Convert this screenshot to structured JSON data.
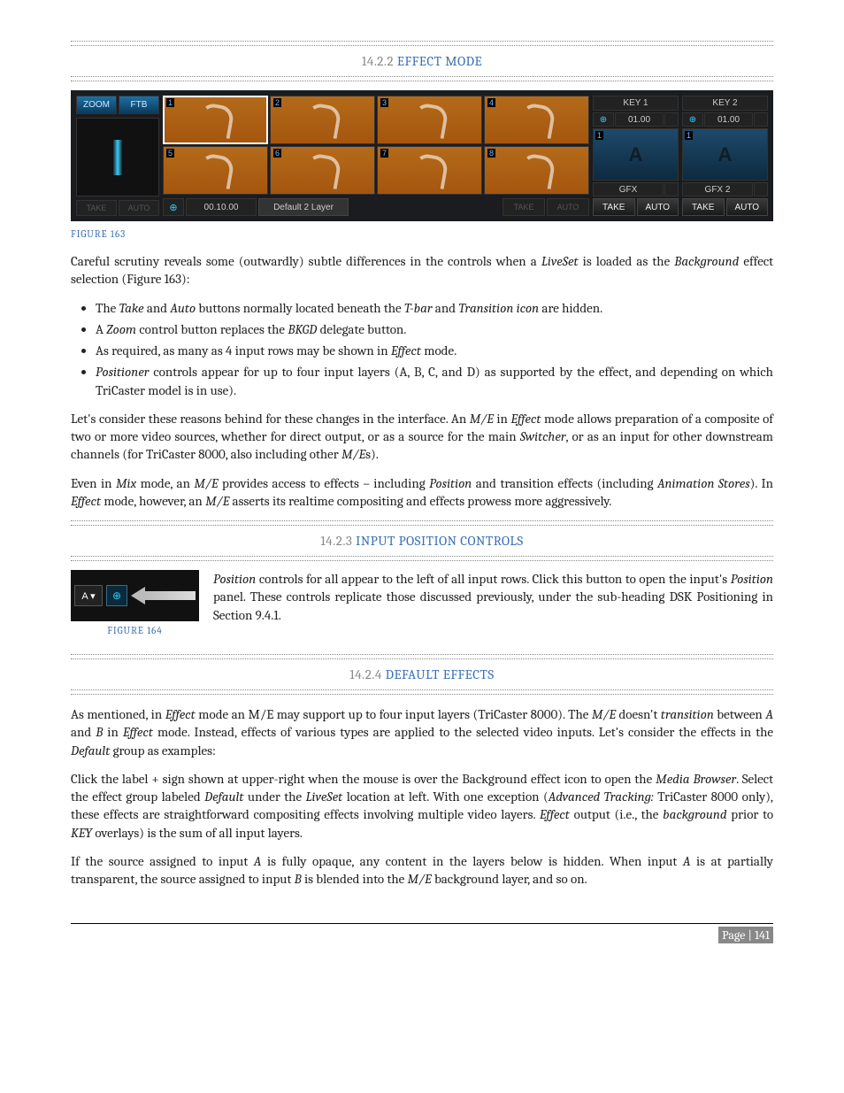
{
  "section1": {
    "num": "14.2.2",
    "title": "EFFECT MODE"
  },
  "fig163": {
    "caption": "FIGURE 163",
    "zoom": "ZOOM",
    "ftb": "FTB",
    "take": "TAKE",
    "auto": "AUTO",
    "tiles": [
      "1",
      "2",
      "3",
      "4",
      "5",
      "6",
      "7",
      "8"
    ],
    "time": "00.10.00",
    "default": "Default  2 Layer",
    "pos": "⊕",
    "keys": [
      {
        "hdr": "KEY 1",
        "time": "01.00",
        "thumb": "A",
        "tl": "1",
        "gfx": "GFX",
        "take": "TAKE",
        "auto": "AUTO"
      },
      {
        "hdr": "KEY 2",
        "time": "01.00",
        "thumb": "A",
        "tl": "1",
        "gfx": "GFX 2",
        "take": "TAKE",
        "auto": "AUTO"
      }
    ]
  },
  "body1": {
    "p1a": "Careful scrutiny reveals some (outwardly) subtle differences in the controls when a ",
    "p1b": "LiveSet",
    "p1c": " is loaded as the ",
    "p1d": "Background",
    "p1e": " effect selection (Figure 163):",
    "li1a": "The ",
    "li1b": "Take",
    "li1c": " and ",
    "li1d": "Auto",
    "li1e": " buttons normally located beneath the ",
    "li1f": "T-bar",
    "li1g": " and ",
    "li1h": "Transition icon",
    "li1i": " are hidden.",
    "li2a": "A ",
    "li2b": "Zoom",
    "li2c": " control button replaces the ",
    "li2d": "BKGD",
    "li2e": " delegate button.",
    "li3a": "As required, as many as 4 input rows may be shown in ",
    "li3b": "Effect",
    "li3c": " mode.",
    "li4a": "Positioner",
    "li4b": " controls appear for up to four input layers (A, B, C, and D) as supported by the effect, and depending on which TriCaster model is in use).",
    "p2a": "Let's consider these reasons behind for these changes in the interface.  An ",
    "p2b": "M/E",
    "p2c": " in ",
    "p2d": "Effect",
    "p2e": " mode allows preparation of a composite of two or more video sources, whether for direct output, or as a source for the main ",
    "p2f": "Switcher",
    "p2g": ", or as an input for other downstream channels (for TriCaster 8000, also including other ",
    "p2h": "M/E",
    "p2i": "s).",
    "p3a": "Even in ",
    "p3b": "Mix",
    "p3c": " mode, an ",
    "p3d": "M/E",
    "p3e": " provides access to effects – including ",
    "p3f": "Position",
    "p3g": " and transition effects (including ",
    "p3h": "Animation Stores",
    "p3i": ").  In ",
    "p3j": "Effect",
    "p3k": " mode, however, an ",
    "p3l": "M/E",
    "p3m": " asserts its realtime compositing and effects prowess more aggressively."
  },
  "section2": {
    "num": "14.2.3",
    "title": "INPUT POSITION CONTROLS"
  },
  "fig164": {
    "caption": "FIGURE 164",
    "a": "A ▾",
    "pos": "⊕"
  },
  "body2": {
    "p1a": "Position",
    "p1b": " controls for all appear to the left of all input rows.  Click this button to open the input's ",
    "p1c": "Position",
    "p1d": " panel.  These controls replicate those discussed previously, under the sub-heading DSK Positioning in Section 9.4.1."
  },
  "section3": {
    "num": "14.2.4",
    "title": "DEFAULT EFFECTS"
  },
  "body3": {
    "p1a": "As mentioned, in ",
    "p1b": "Effect",
    "p1c": " mode an M/E may support up to four input layers (TriCaster 8000).  The ",
    "p1d": "M/E",
    "p1e": " doesn't ",
    "p1f": "transition",
    "p1g": " between ",
    "p1h": "A",
    "p1i": " and ",
    "p1j": "B",
    "p1k": " in ",
    "p1l": "Effect",
    "p1m": " mode.  Instead, effects of various types are applied to the selected video inputs. Let's consider the effects in the ",
    "p1n": "Default",
    "p1o": " group as examples:",
    "p2a": "Click the label + sign shown at upper-right when the mouse is over the Background effect icon to open the ",
    "p2b": "Media Browser",
    "p2c": ".  Select the effect group labeled ",
    "p2d": "Default",
    "p2e": " under the ",
    "p2f": "LiveSet",
    "p2g": " location at left.   With one exception (",
    "p2h": "Advanced Tracking:",
    "p2i": " TriCaster 8000 only), these effects are straightforward compositing effects involving multiple video layers. ",
    "p2j": "Effect",
    "p2k": " output (i.e., the ",
    "p2l": "background",
    "p2m": " prior to ",
    "p2n": "KEY",
    "p2o": " overlays) is the sum of all input layers.",
    "p3a": "If the source assigned to input ",
    "p3b": "A",
    "p3c": " is fully opaque, any content in the layers below is hidden.  When input ",
    "p3d": "A",
    "p3e": " is at partially transparent, the source assigned to input ",
    "p3f": "B",
    "p3g": " is blended into the ",
    "p3h": "M/E",
    "p3i": " background layer, and so on."
  },
  "footer": {
    "page": "Page | 141"
  }
}
